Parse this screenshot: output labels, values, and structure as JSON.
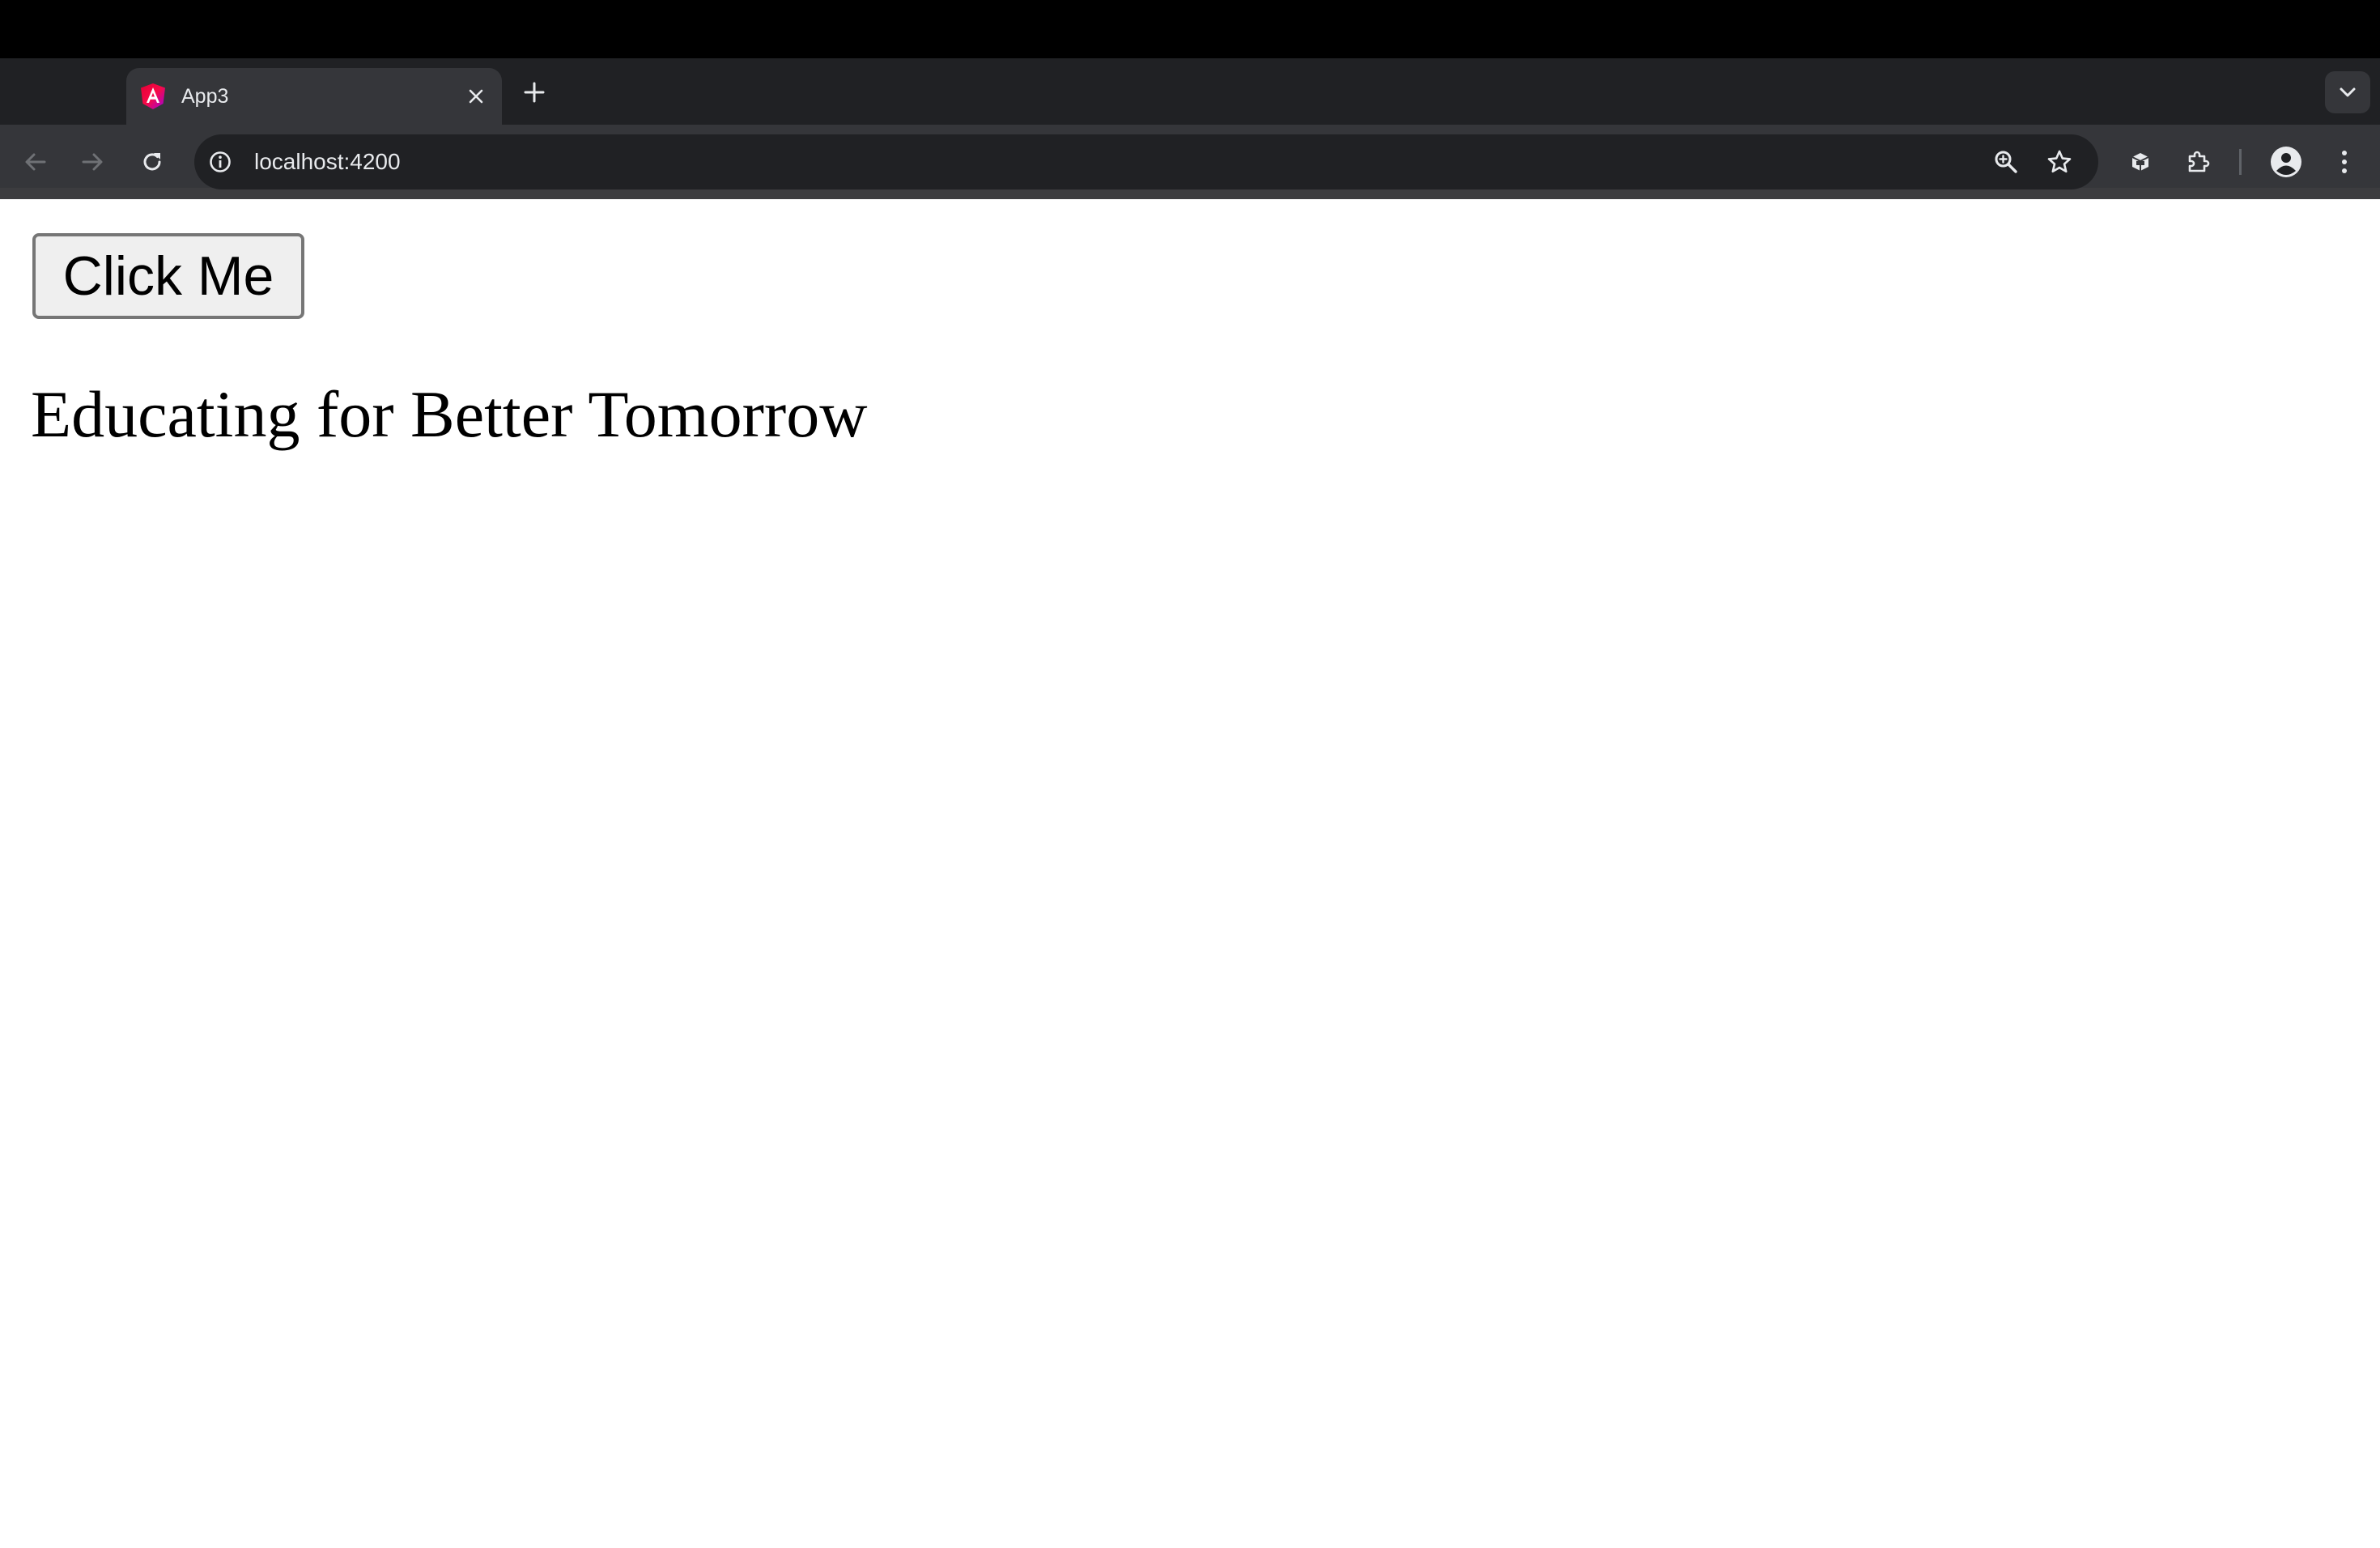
{
  "browser": {
    "tab": {
      "title": "App3",
      "favicon": "angular-logo-icon",
      "close_icon": "close-icon"
    },
    "new_tab_icon": "plus-icon",
    "tab_search_icon": "chevron-down-icon",
    "toolbar": {
      "back_icon": "arrow-left-icon",
      "forward_icon": "arrow-right-icon",
      "reload_icon": "reload-icon",
      "site_info_icon": "info-icon",
      "url": "localhost:4200",
      "zoom_icon": "zoom-icon",
      "bookmark_icon": "star-icon",
      "extension_1_icon": "extension-icon",
      "extensions_icon": "puzzle-icon",
      "profile_icon": "avatar-icon",
      "menu_icon": "kebab-menu-icon"
    },
    "colors": {
      "frame": "#202124",
      "toolbar": "#35363a",
      "omnibox": "#202124",
      "text": "#e8eaed"
    }
  },
  "page": {
    "button_label": "Click Me",
    "heading": "Educating for Better Tomorrow"
  }
}
